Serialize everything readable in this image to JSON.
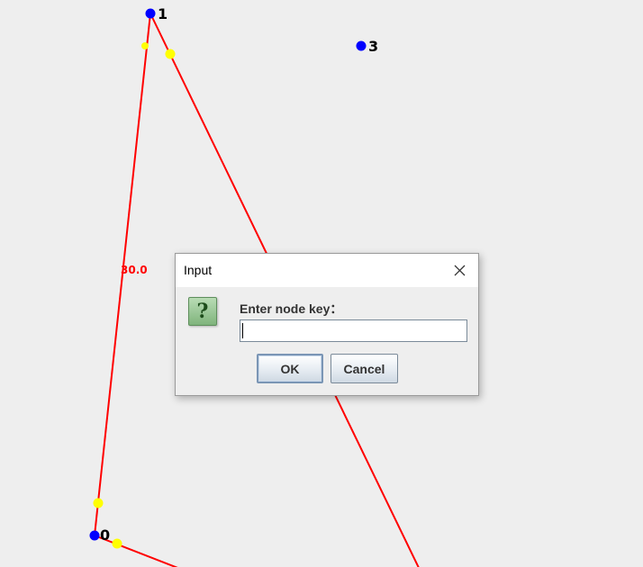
{
  "graph": {
    "nodes": [
      {
        "key": "1"
      },
      {
        "key": "3"
      },
      {
        "key": "0"
      }
    ],
    "edge_weights": [
      "30.0"
    ],
    "colors": {
      "edge": "#ff0000",
      "node": "#0000ff",
      "anchor": "#ffff00",
      "canvas": "#eeeeee"
    }
  },
  "dialog": {
    "title": "Input",
    "icon": "question-icon",
    "icon_glyph": "?",
    "close_icon": "close-icon",
    "prompt": "Enter node key：",
    "input_value": "",
    "ok_label": "OK",
    "cancel_label": "Cancel"
  }
}
